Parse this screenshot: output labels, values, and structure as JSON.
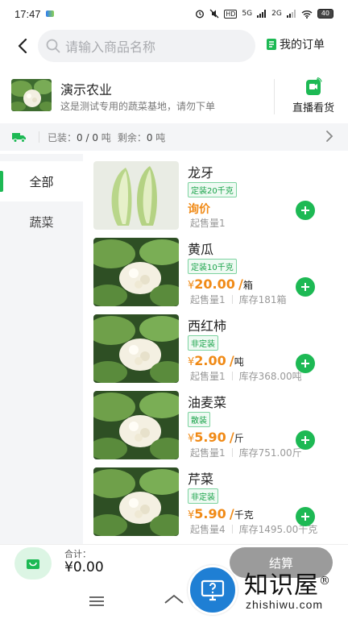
{
  "status_bar": {
    "time": "17:47",
    "network_5g": "5G",
    "network_2g": "2G",
    "hd": "HD",
    "battery": "40"
  },
  "header": {
    "search_placeholder": "请输入商品名称",
    "my_order_label": "我的订单"
  },
  "farm": {
    "name": "演示农业",
    "description": "这是测试专用的蔬菜基地，请勿下单",
    "live_label": "直播看货"
  },
  "load": {
    "loaded_label": "已装：",
    "loaded_value": "0 / 0",
    "loaded_unit": "吨",
    "remaining_label": "剩余：",
    "remaining_value": "0",
    "remaining_unit": "吨"
  },
  "categories": [
    {
      "label": "全部",
      "active": true
    },
    {
      "label": "蔬菜",
      "active": false
    }
  ],
  "products": [
    {
      "name": "龙牙",
      "tag": "定装20千克",
      "inquiry": "询价",
      "min_order": "起售量1",
      "image": "cabbage"
    },
    {
      "name": "黄瓜",
      "tag": "定装10千克",
      "currency": "¥",
      "price": "20.00",
      "unit": "/",
      "unit_name": "箱",
      "min_order": "起售量1",
      "stock": "库存181箱",
      "image": "cauliflower"
    },
    {
      "name": "西红柿",
      "tag": "非定装",
      "currency": "¥",
      "price": "2.00",
      "unit": "/",
      "unit_name": "吨",
      "min_order": "起售量1",
      "stock": "库存368.00吨",
      "image": "cauliflower"
    },
    {
      "name": "油麦菜",
      "tag": "散装",
      "currency": "¥",
      "price": "5.90",
      "unit": "/",
      "unit_name": "斤",
      "min_order": "起售量1",
      "stock": "库存751.00斤",
      "image": "cauliflower"
    },
    {
      "name": "芹菜",
      "tag": "非定装",
      "currency": "¥",
      "price": "5.90",
      "unit": "/",
      "unit_name": "千克",
      "min_order": "起售量4",
      "stock": "库存1495.00千克",
      "image": "cauliflower"
    }
  ],
  "cart": {
    "total_label": "合计：",
    "total_value": "¥0.00",
    "checkout_label": "结算"
  },
  "watermark": {
    "title": "知识屋",
    "registered": "®",
    "subtitle": "zhishiwu.com"
  },
  "colors": {
    "primary": "#1db954",
    "price": "#f08a16",
    "checkout_disabled": "#9b9b9b",
    "watermark_blue": "#1f7fd4"
  },
  "icons": [
    "back-arrow-icon",
    "search-icon",
    "order-icon",
    "live-camera-icon",
    "truck-icon",
    "chevron-right-icon",
    "plus-icon",
    "shopping-bag-icon",
    "menu-icon",
    "home-icon",
    "help-monitor-icon"
  ]
}
